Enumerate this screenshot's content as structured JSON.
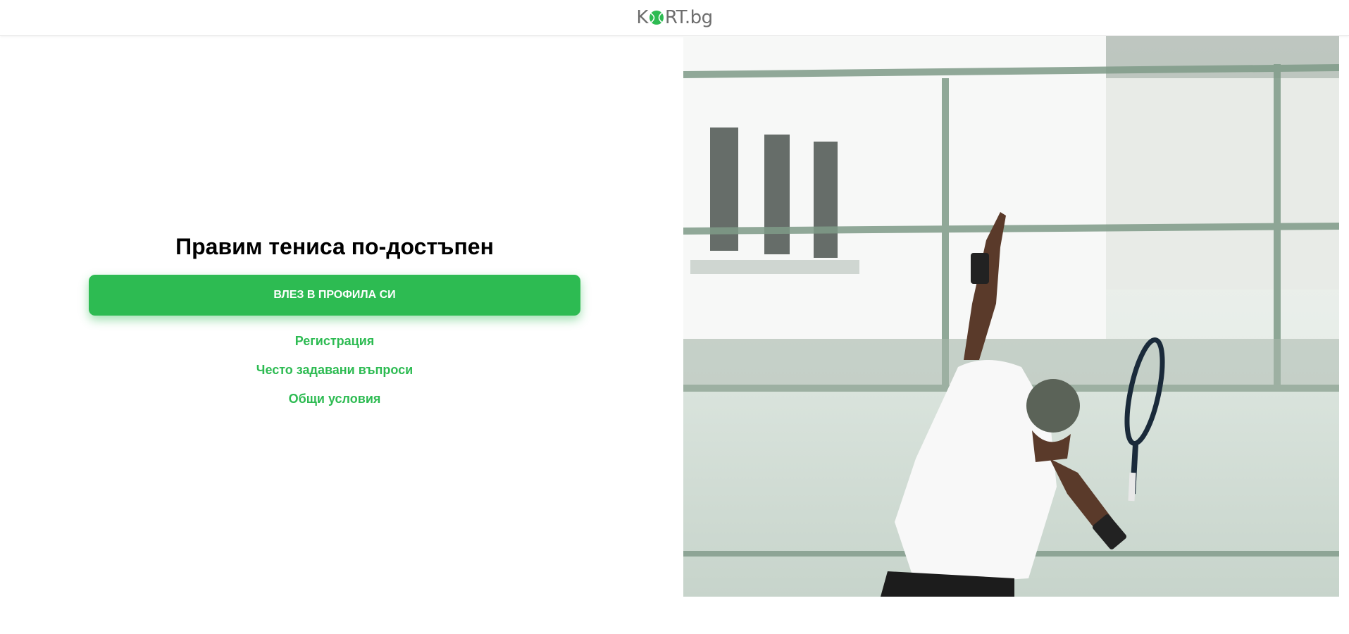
{
  "header": {
    "logo_text_before": "K",
    "logo_text_after": "RT.bg"
  },
  "main": {
    "headline": "Правим тениса по-достъпен",
    "login_button": "ВЛЕЗ В ПРОФИЛА СИ",
    "links": {
      "register": "Регистрация",
      "faq": "Често задавани въпроси",
      "terms": "Общи условия"
    }
  },
  "colors": {
    "accent": "#2dbb52",
    "logo_text": "#6e6e6e"
  },
  "hero_image": {
    "subject": "tennis player serving on court"
  }
}
